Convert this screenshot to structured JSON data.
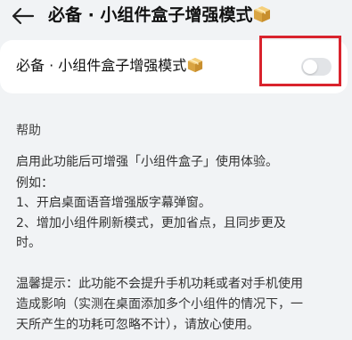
{
  "header": {
    "back_icon": "back-arrow-icon",
    "title": "必备 · 小组件盒子增强模式"
  },
  "setting": {
    "label": "必备 · 小组件盒子增强模式",
    "toggle_on": false,
    "toggle_color": "#e2e4e7"
  },
  "help": {
    "title": "帮助",
    "intro": "启用此功能后可增强「小组件盒子」使用体验。",
    "example_label": "例如：",
    "item1": "1、开启桌面语音增强版字幕弹窗。",
    "item2_line1": "2、增加小组件刷新模式，更加省点，且同步更及",
    "item2_line2": "时。",
    "tip_line1": "温馨提示：此功能不会提升手机功耗或者对手机使用",
    "tip_line2": "造成影响（实测在桌面添加多个小组件的情况下，一",
    "tip_line3": "天所产生的功耗可忽略不计），请放心使用。"
  },
  "colors": {
    "background": "#f1f3f5",
    "card": "#ffffff",
    "highlight": "#d9232d"
  }
}
